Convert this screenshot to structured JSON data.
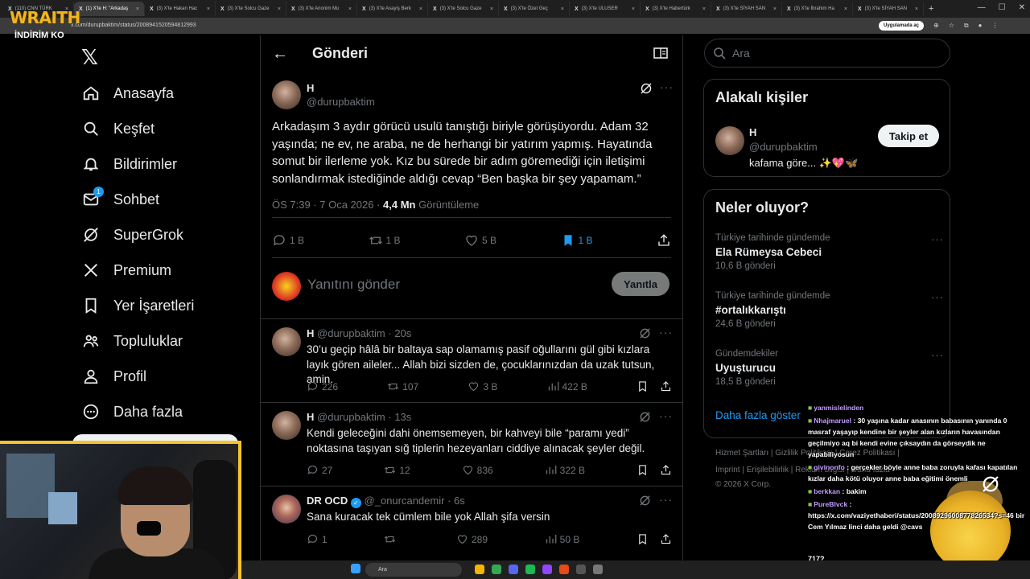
{
  "browser": {
    "tabs": [
      {
        "label": "(110) CNN TÜRK",
        "active": false
      },
      {
        "label": "(1) X'te H: \"Arkadaş",
        "active": true
      },
      {
        "label": "(3) X'te Hakan Hac",
        "active": false
      },
      {
        "label": "(3) X'te Solcu Gaze",
        "active": false
      },
      {
        "label": "(3) X'te Anonim Mu",
        "active": false
      },
      {
        "label": "(3) X'te Asayiş Berk",
        "active": false
      },
      {
        "label": "(3) X'te Solcu Gaze",
        "active": false
      },
      {
        "label": "(3) X'te Özet Geç",
        "active": false
      },
      {
        "label": "(3) X'te ULUSER",
        "active": false
      },
      {
        "label": "(3) X'te Habertürk",
        "active": false
      },
      {
        "label": "(3) X'te SİYAH SAN",
        "active": false
      },
      {
        "label": "(3) X'te İbrahim Ha",
        "active": false
      },
      {
        "label": "(3) X'te SİYAH SAN",
        "active": false
      }
    ],
    "url": "x.com/durupbaktim/status/2008941520594812993",
    "open_in_app": "Uygulamada aç"
  },
  "overlay": {
    "logo": "WRAITH",
    "promo": "İNDİRİM KO"
  },
  "nav": {
    "items": [
      {
        "label": "Anasayfa",
        "icon": "home-icon"
      },
      {
        "label": "Keşfet",
        "icon": "search-icon"
      },
      {
        "label": "Bildirimler",
        "icon": "bell-icon"
      },
      {
        "label": "Sohbet",
        "icon": "mail-icon",
        "badge": "1"
      },
      {
        "label": "SuperGrok",
        "icon": "grok-icon"
      },
      {
        "label": "Premium",
        "icon": "x-icon"
      },
      {
        "label": "Yer İşaretleri",
        "icon": "bookmark-icon"
      },
      {
        "label": "Topluluklar",
        "icon": "communities-icon"
      },
      {
        "label": "Profil",
        "icon": "profile-icon"
      },
      {
        "label": "Daha fazla",
        "icon": "more-circle-icon"
      }
    ]
  },
  "header": {
    "title": "Gönderi"
  },
  "post": {
    "name": "H",
    "handle": "@durupbaktim",
    "text": "Arkadaşım 3 aydır görücü usulü tanıştığı biriyle görüşüyordu. Adam 32 yaşında; ne ev, ne araba, ne de herhangi bir yatırım yapmış. Hayatında somut bir ilerleme yok. Kız bu sürede bir adım göremediği için iletişimi sonlandırmak istediğinde aldığı cevap “Ben başka bir şey yapamam.”",
    "time": "ÖS 7:39 · 7 Oca 2026 · ",
    "views": "4,4 Mn",
    "views_label": " Görüntüleme",
    "replies": "1 B",
    "reposts": "1 B",
    "likes": "5 B",
    "bookmarks": "1 B"
  },
  "reply_box": {
    "placeholder": "Yanıtını gönder",
    "button": "Yanıtla"
  },
  "replies": [
    {
      "name": "H",
      "handle": "@durupbaktim",
      "time": "· 20s",
      "verified": false,
      "text": "30’u geçip hâlâ bir baltaya sap olamamış pasif oğullarını gül gibi kızlara layık gören aileler... Allah bizi sizden de, çocuklarınızdan da uzak tutsun, amin.",
      "replies": "226",
      "reposts": "107",
      "likes": "3 B",
      "views": "422 B"
    },
    {
      "name": "H",
      "handle": "@durupbaktim",
      "time": "· 13s",
      "verified": false,
      "text": "Kendi geleceğini dahi önemsemeyen, bir kahveyi bile “paramı yedi” noktasına taşıyan sığ tiplerin hezeyanları ciddiye alınacak şeyler değil.",
      "replies": "27",
      "reposts": "12",
      "likes": "836",
      "views": "322 B"
    },
    {
      "name": "DR OCD",
      "handle": "@_onurcandemir",
      "time": "· 6s",
      "verified": true,
      "text": "Sana kuracak tek cümlem bile yok Allah şifa versin",
      "replies": "1",
      "reposts": "",
      "likes": "289",
      "views": "50 B"
    }
  ],
  "right": {
    "search_placeholder": "Ara",
    "related": {
      "title": "Alakalı kişiler",
      "name": "H",
      "handle": "@durupbaktim",
      "bio": "kafama göre... ✨💖🦋",
      "follow": "Takip et"
    },
    "trends": {
      "title": "Neler oluyor?",
      "items": [
        {
          "context": "Türkiye tarihinde gündemde",
          "topic": "Ela Rümeysa Cebeci",
          "count": "10,6 B gönderi"
        },
        {
          "context": "Türkiye tarihinde gündemde",
          "topic": "#ortalıkkarıştı",
          "count": "24,6 B gönderi"
        },
        {
          "context": "Gündemdekiler",
          "topic": "Uyuşturucu",
          "count": "18,5 B gönderi"
        }
      ],
      "show_more": "Daha fazla göster"
    },
    "footer": {
      "line1": "Hizmet Şartları  |  Gizlilik Politikası  |  Çerez Politikası  |",
      "line2": "Imprint  |  Erişilebilirlik  |  Reklam bilgisi  |  Daha fazla ···",
      "line3": "© 2026 X Corp."
    }
  },
  "chat": [
    {
      "user": "yanmislelinden",
      "msg": ""
    },
    {
      "user": "Nhajmaruel",
      "msg": "30 yaşına kadar anasının babasının yanında 0 masraf yaşayıp kendine bir şeyler alan kızların havasından geçilmiyo aq bi kendi evine çıksaydın da görseydik ne yapabiliyosun"
    },
    {
      "user": "givinonfo",
      "msg": "gerçekler böyle anne baba zoruyla kafası kapatılan kızlar daha kötü oluyor anne baba eğitimi önemli"
    },
    {
      "user": "berkkan",
      "msg": "bakim"
    },
    {
      "user": "PureBlvck",
      "msg": "https://x.com/vaziyethaberi/status/2008929600877826534?s=46 bir Cem Yılmaz linci daha geldi @cavs"
    }
  ],
  "chat_extra": "717?",
  "taskbar": {
    "search": "Ara"
  }
}
